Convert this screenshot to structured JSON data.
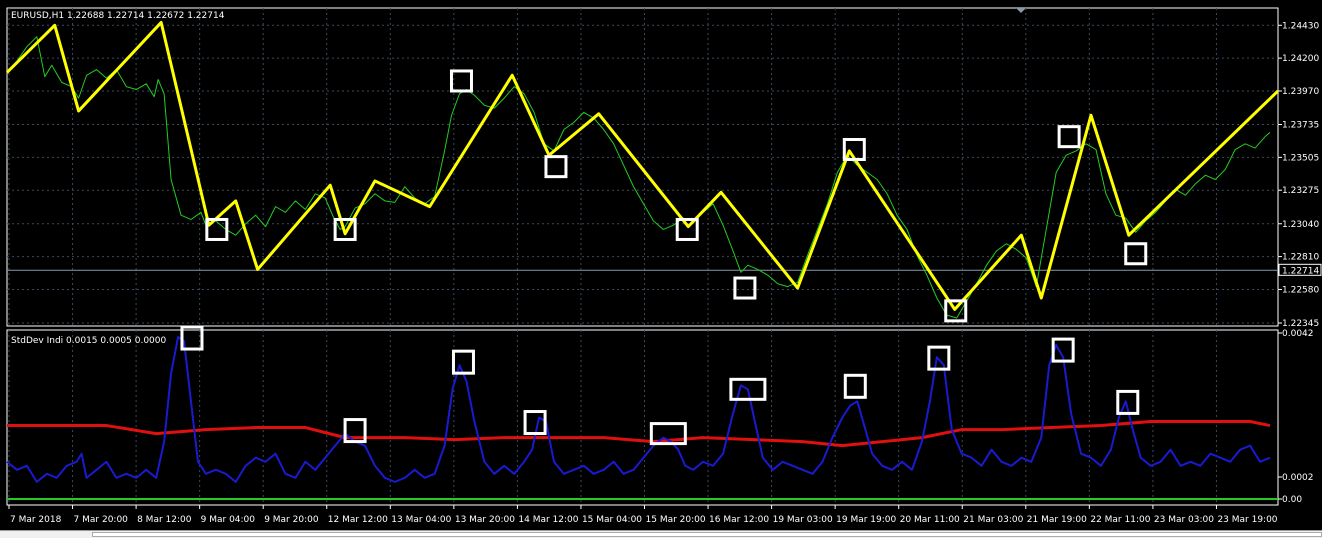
{
  "colors": {
    "background": "#000000",
    "axis": "#ffffff",
    "grid": "#3a4a5a",
    "price_line": "#22cc22",
    "zigzag": "#ffff00",
    "std_line": "#1a1ad0",
    "avg_line": "#e01010",
    "zero_line": "#22cc22",
    "marker": "#ffffff"
  },
  "chart_data": [
    {
      "type": "line",
      "panel": "price",
      "title": "EURUSD,H1  1.22688 1.22714 1.22672 1.22714",
      "symbol": "EURUSD,H1",
      "ohlc": [
        "1.22688",
        "1.22714",
        "1.22672",
        "1.22714"
      ],
      "ylim": [
        1.22345,
        1.2453
      ],
      "y_ticks": [
        "1.24430",
        "1.24200",
        "1.23970",
        "1.23735",
        "1.23505",
        "1.23275",
        "1.23040",
        "1.22810",
        "1.22580",
        "1.22345"
      ],
      "current_price": "1.22714",
      "x_ticks": [
        "7 Mar 2018",
        "7 Mar 20:00",
        "8 Mar 12:00",
        "9 Mar 04:00",
        "9 Mar 20:00",
        "12 Mar 12:00",
        "13 Mar 04:00",
        "13 Mar 20:00",
        "14 Mar 12:00",
        "15 Mar 04:00",
        "15 Mar 20:00",
        "16 Mar 12:00",
        "19 Mar 03:00",
        "19 Mar 19:00",
        "20 Mar 11:00",
        "21 Mar 03:00",
        "21 Mar 19:00",
        "22 Mar 11:00",
        "23 Mar 03:00",
        "23 Mar 19:00"
      ],
      "x_range": [
        0,
        1270
      ],
      "series": [
        {
          "role": "price",
          "x": [
            0,
            10,
            20,
            30,
            38,
            45,
            55,
            65,
            72,
            80,
            90,
            100,
            110,
            120,
            130,
            140,
            148,
            152,
            158,
            165,
            175,
            185,
            195,
            200,
            210,
            220,
            230,
            240,
            250,
            260,
            270,
            280,
            290,
            300,
            310,
            320,
            328,
            335,
            340,
            350,
            360,
            370,
            380,
            390,
            400,
            410,
            420,
            430,
            440,
            447,
            455,
            462,
            470,
            480,
            490,
            500,
            510,
            520,
            530,
            540,
            550,
            560,
            570,
            580,
            590,
            600,
            610,
            620,
            630,
            640,
            650,
            660,
            670,
            680,
            690,
            700,
            710,
            720,
            730,
            738,
            745,
            755,
            765,
            775,
            785,
            795,
            805,
            815,
            825,
            835,
            845,
            855,
            865,
            875,
            885,
            895,
            905,
            915,
            925,
            935,
            945,
            955,
            965,
            975,
            985,
            995,
            1005,
            1015,
            1025,
            1035,
            1045,
            1055,
            1065,
            1075,
            1085,
            1095,
            1105,
            1115,
            1125,
            1135,
            1145,
            1155,
            1165,
            1175,
            1185,
            1195,
            1205,
            1215,
            1225,
            1235,
            1245,
            1255,
            1265,
            1270
          ],
          "values": [
            1.241,
            1.2418,
            1.2428,
            1.2435,
            1.2407,
            1.2415,
            1.2403,
            1.24,
            1.2392,
            1.2408,
            1.2412,
            1.2406,
            1.2412,
            1.24,
            1.2398,
            1.2402,
            1.2393,
            1.2405,
            1.2395,
            1.2335,
            1.231,
            1.2307,
            1.2312,
            1.2303,
            1.2306,
            1.23,
            1.2296,
            1.2304,
            1.231,
            1.2302,
            1.2316,
            1.2312,
            1.232,
            1.2314,
            1.2325,
            1.2322,
            1.2309,
            1.23,
            1.2302,
            1.2315,
            1.2318,
            1.2325,
            1.232,
            1.2319,
            1.233,
            1.2322,
            1.2318,
            1.2323,
            1.2355,
            1.238,
            1.2395,
            1.2398,
            1.2394,
            1.2387,
            1.2385,
            1.2392,
            1.24,
            1.2395,
            1.2382,
            1.236,
            1.2355,
            1.237,
            1.2375,
            1.2382,
            1.2378,
            1.237,
            1.236,
            1.2345,
            1.233,
            1.2318,
            1.2306,
            1.23,
            1.2303,
            1.2308,
            1.2306,
            1.2312,
            1.2318,
            1.2303,
            1.2285,
            1.227,
            1.2275,
            1.2272,
            1.2268,
            1.2262,
            1.226,
            1.2263,
            1.2282,
            1.23,
            1.2318,
            1.234,
            1.2352,
            1.2345,
            1.234,
            1.2335,
            1.2325,
            1.231,
            1.23,
            1.2282,
            1.2268,
            1.2252,
            1.224,
            1.2238,
            1.225,
            1.2262,
            1.2275,
            1.2285,
            1.229,
            1.2286,
            1.228,
            1.226,
            1.23,
            1.234,
            1.2352,
            1.2355,
            1.236,
            1.2356,
            1.2325,
            1.231,
            1.2308,
            1.2298,
            1.2306,
            1.2312,
            1.232,
            1.2328,
            1.2324,
            1.2332,
            1.2338,
            1.2335,
            1.2342,
            1.2356,
            1.236,
            1.2357,
            1.2365,
            1.2368
          ]
        },
        {
          "role": "zigzag",
          "x": [
            0,
            48,
            72,
            155,
            203,
            230,
            252,
            325,
            340,
            370,
            425,
            508,
            545,
            595,
            685,
            718,
            795,
            847,
            953,
            1020,
            1040,
            1090,
            1128,
            1278
          ],
          "values": [
            1.241,
            1.2443,
            1.2383,
            1.2445,
            1.2303,
            1.232,
            1.2272,
            1.2331,
            1.2297,
            1.2334,
            1.2316,
            1.2408,
            1.2352,
            1.2381,
            1.2302,
            1.2326,
            1.2259,
            1.2355,
            1.2244,
            1.2296,
            1.2252,
            1.238,
            1.2296,
            1.2397
          ]
        }
      ],
      "markers": [
        {
          "x": 211,
          "y": 1.23
        },
        {
          "x": 340,
          "y": 1.23
        },
        {
          "x": 457,
          "y": 1.2404
        },
        {
          "x": 552,
          "y": 1.2344
        },
        {
          "x": 684,
          "y": 1.23
        },
        {
          "x": 742,
          "y": 1.2259
        },
        {
          "x": 852,
          "y": 1.2356
        },
        {
          "x": 954,
          "y": 1.2243
        },
        {
          "x": 1068,
          "y": 1.2365
        },
        {
          "x": 1135,
          "y": 1.2283
        }
      ]
    },
    {
      "type": "line",
      "panel": "indicator",
      "title": "StdDev Indi 0.0015 0.0005 0.0000",
      "name": "StdDev Indi",
      "params": [
        "0.0015",
        "0.0005",
        "0.0000"
      ],
      "ylim": [
        0,
        0.0042
      ],
      "y_ticks": [
        "0.0042",
        "0.0002",
        "0.00"
      ],
      "x_range": [
        0,
        1270
      ],
      "series": [
        {
          "role": "stddev",
          "x": [
            0,
            10,
            20,
            30,
            40,
            50,
            60,
            70,
            75,
            80,
            90,
            100,
            110,
            120,
            130,
            140,
            150,
            158,
            165,
            172,
            178,
            185,
            192,
            200,
            210,
            220,
            230,
            240,
            250,
            260,
            270,
            280,
            290,
            300,
            310,
            320,
            330,
            340,
            350,
            360,
            370,
            380,
            390,
            400,
            410,
            420,
            430,
            440,
            448,
            455,
            462,
            470,
            480,
            490,
            500,
            510,
            520,
            528,
            535,
            542,
            550,
            560,
            570,
            580,
            590,
            600,
            610,
            620,
            630,
            640,
            650,
            660,
            668,
            675,
            682,
            690,
            700,
            710,
            720,
            730,
            738,
            745,
            752,
            760,
            770,
            780,
            790,
            800,
            810,
            820,
            830,
            840,
            848,
            855,
            862,
            870,
            880,
            890,
            900,
            910,
            920,
            928,
            935,
            942,
            950,
            960,
            970,
            980,
            990,
            1000,
            1010,
            1020,
            1030,
            1040,
            1048,
            1055,
            1062,
            1070,
            1080,
            1090,
            1100,
            1110,
            1118,
            1125,
            1132,
            1140,
            1150,
            1160,
            1170,
            1180,
            1190,
            1200,
            1210,
            1220,
            1230,
            1240,
            1250,
            1260,
            1270
          ],
          "values": [
            0.001,
            0.0008,
            0.0009,
            0.0005,
            0.0007,
            0.0006,
            0.0009,
            0.001,
            0.0012,
            0.0006,
            0.0008,
            0.001,
            0.0006,
            0.0007,
            0.0006,
            0.0008,
            0.0006,
            0.0015,
            0.0032,
            0.0041,
            0.004,
            0.0025,
            0.001,
            0.0007,
            0.0008,
            0.0007,
            0.0005,
            0.0009,
            0.0011,
            0.001,
            0.0012,
            0.0007,
            0.0006,
            0.001,
            0.0008,
            0.0011,
            0.0014,
            0.0017,
            0.0015,
            0.0014,
            0.0009,
            0.0006,
            0.0005,
            0.0006,
            0.0008,
            0.0006,
            0.0007,
            0.0014,
            0.0028,
            0.0034,
            0.003,
            0.002,
            0.001,
            0.0007,
            0.0009,
            0.0007,
            0.001,
            0.0013,
            0.0021,
            0.002,
            0.001,
            0.0007,
            0.0008,
            0.0009,
            0.0007,
            0.0008,
            0.001,
            0.0007,
            0.0008,
            0.0011,
            0.0014,
            0.0016,
            0.0015,
            0.0013,
            0.0009,
            0.0008,
            0.001,
            0.0009,
            0.0012,
            0.0022,
            0.0029,
            0.0028,
            0.002,
            0.0011,
            0.0008,
            0.001,
            0.0009,
            0.0008,
            0.0007,
            0.001,
            0.0016,
            0.0021,
            0.0024,
            0.0025,
            0.0019,
            0.0012,
            0.0009,
            0.0008,
            0.001,
            0.0008,
            0.0015,
            0.0025,
            0.0036,
            0.0034,
            0.0018,
            0.0012,
            0.0011,
            0.0009,
            0.0013,
            0.001,
            0.0009,
            0.0011,
            0.001,
            0.0016,
            0.0034,
            0.0039,
            0.0036,
            0.0022,
            0.0012,
            0.0011,
            0.0009,
            0.0013,
            0.0021,
            0.0025,
            0.0018,
            0.0011,
            0.0009,
            0.001,
            0.0013,
            0.0009,
            0.001,
            0.0009,
            0.0012,
            0.0011,
            0.001,
            0.0013,
            0.0014,
            0.001,
            0.0011
          ]
        },
        {
          "role": "average",
          "x": [
            0,
            100,
            150,
            200,
            250,
            300,
            340,
            400,
            450,
            500,
            550,
            600,
            650,
            700,
            750,
            800,
            840,
            880,
            920,
            960,
            1000,
            1050,
            1100,
            1150,
            1200,
            1250,
            1270
          ],
          "values": [
            0.0019,
            0.0019,
            0.0017,
            0.0018,
            0.00185,
            0.00185,
            0.0016,
            0.0016,
            0.00155,
            0.0016,
            0.0016,
            0.0016,
            0.0015,
            0.0016,
            0.00155,
            0.0015,
            0.0014,
            0.0015,
            0.0016,
            0.0018,
            0.0018,
            0.00185,
            0.0019,
            0.002,
            0.002,
            0.002,
            0.0019
          ]
        },
        {
          "role": "zero",
          "x": [
            0,
            1270
          ],
          "values": [
            0,
            0
          ]
        }
      ],
      "markers": [
        {
          "x": 186,
          "y": 0.0041,
          "wide": false
        },
        {
          "x": 350,
          "y": 0.0018,
          "wide": false
        },
        {
          "x": 459,
          "y": 0.0035,
          "wide": false
        },
        {
          "x": 531,
          "y": 0.002,
          "wide": false
        },
        {
          "x": 665,
          "y": 0.0017,
          "wide": true
        },
        {
          "x": 745,
          "y": 0.0028,
          "wide": true
        },
        {
          "x": 853,
          "y": 0.0029,
          "wide": false
        },
        {
          "x": 937,
          "y": 0.0036,
          "wide": false
        },
        {
          "x": 1062,
          "y": 0.0038,
          "wide": false
        },
        {
          "x": 1127,
          "y": 0.0025,
          "wide": false
        }
      ]
    }
  ]
}
